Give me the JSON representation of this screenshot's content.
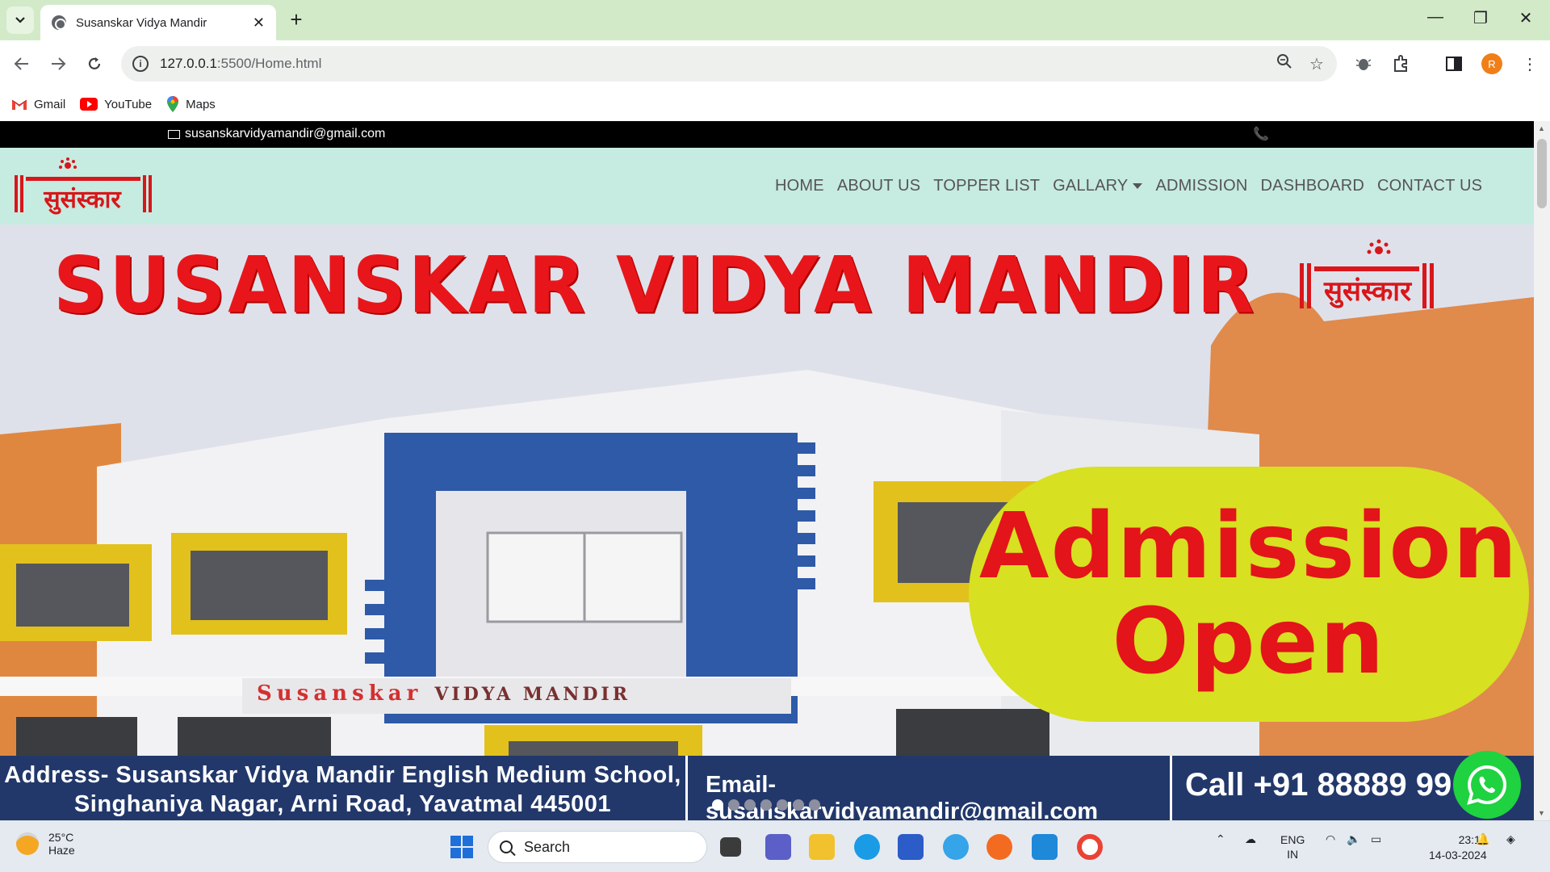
{
  "browser": {
    "tab_title": "Susanskar Vidya Mandir",
    "url_host": "127.0.0.1",
    "url_path": ":5500/Home.html",
    "profile_initial": "R",
    "bookmarks": [
      {
        "label": "Gmail",
        "icon": "gmail-icon"
      },
      {
        "label": "YouTube",
        "icon": "youtube-icon"
      },
      {
        "label": "Maps",
        "icon": "maps-icon"
      }
    ]
  },
  "site": {
    "topbar_email": "susanskarvidyamandir@gmail.com",
    "nav": {
      "home": "HOME",
      "about": "ABOUT US",
      "topper": "TOPPER LIST",
      "gallery": "GALLARY",
      "admission": "ADMISSION",
      "dashboard": "DASHBOARD",
      "contact": "CONTACT US"
    },
    "hero": {
      "title": "SUSANSKAR VIDYA MANDIR",
      "admission_line1": "Admission",
      "admission_line2": "Open",
      "sign_text": "Susanskar",
      "sign_rest": "VIDYA MANDIR",
      "footer_address_1": "Address- Susanskar Vidya Mandir English Medium School,",
      "footer_address_2": "Singhaniya Nagar, Arni Road, Yavatmal 445001",
      "footer_email": "Email- susanskarvidyamandir@gmail.com",
      "footer_call": "Call +91 88889 99",
      "carousel_dots": 7,
      "active_dot": 0
    },
    "colors": {
      "accent_red": "#e8161b",
      "navbar_bg": "#c6ebe0",
      "admission_bg": "#d7e021",
      "footer_bg": "#22386b",
      "whatsapp": "#1fd240"
    }
  },
  "taskbar": {
    "temperature": "25°C",
    "weather": "Haze",
    "search_label": "Search",
    "lang_1": "ENG",
    "lang_2": "IN",
    "time": "23:13",
    "date": "14-03-2024"
  }
}
